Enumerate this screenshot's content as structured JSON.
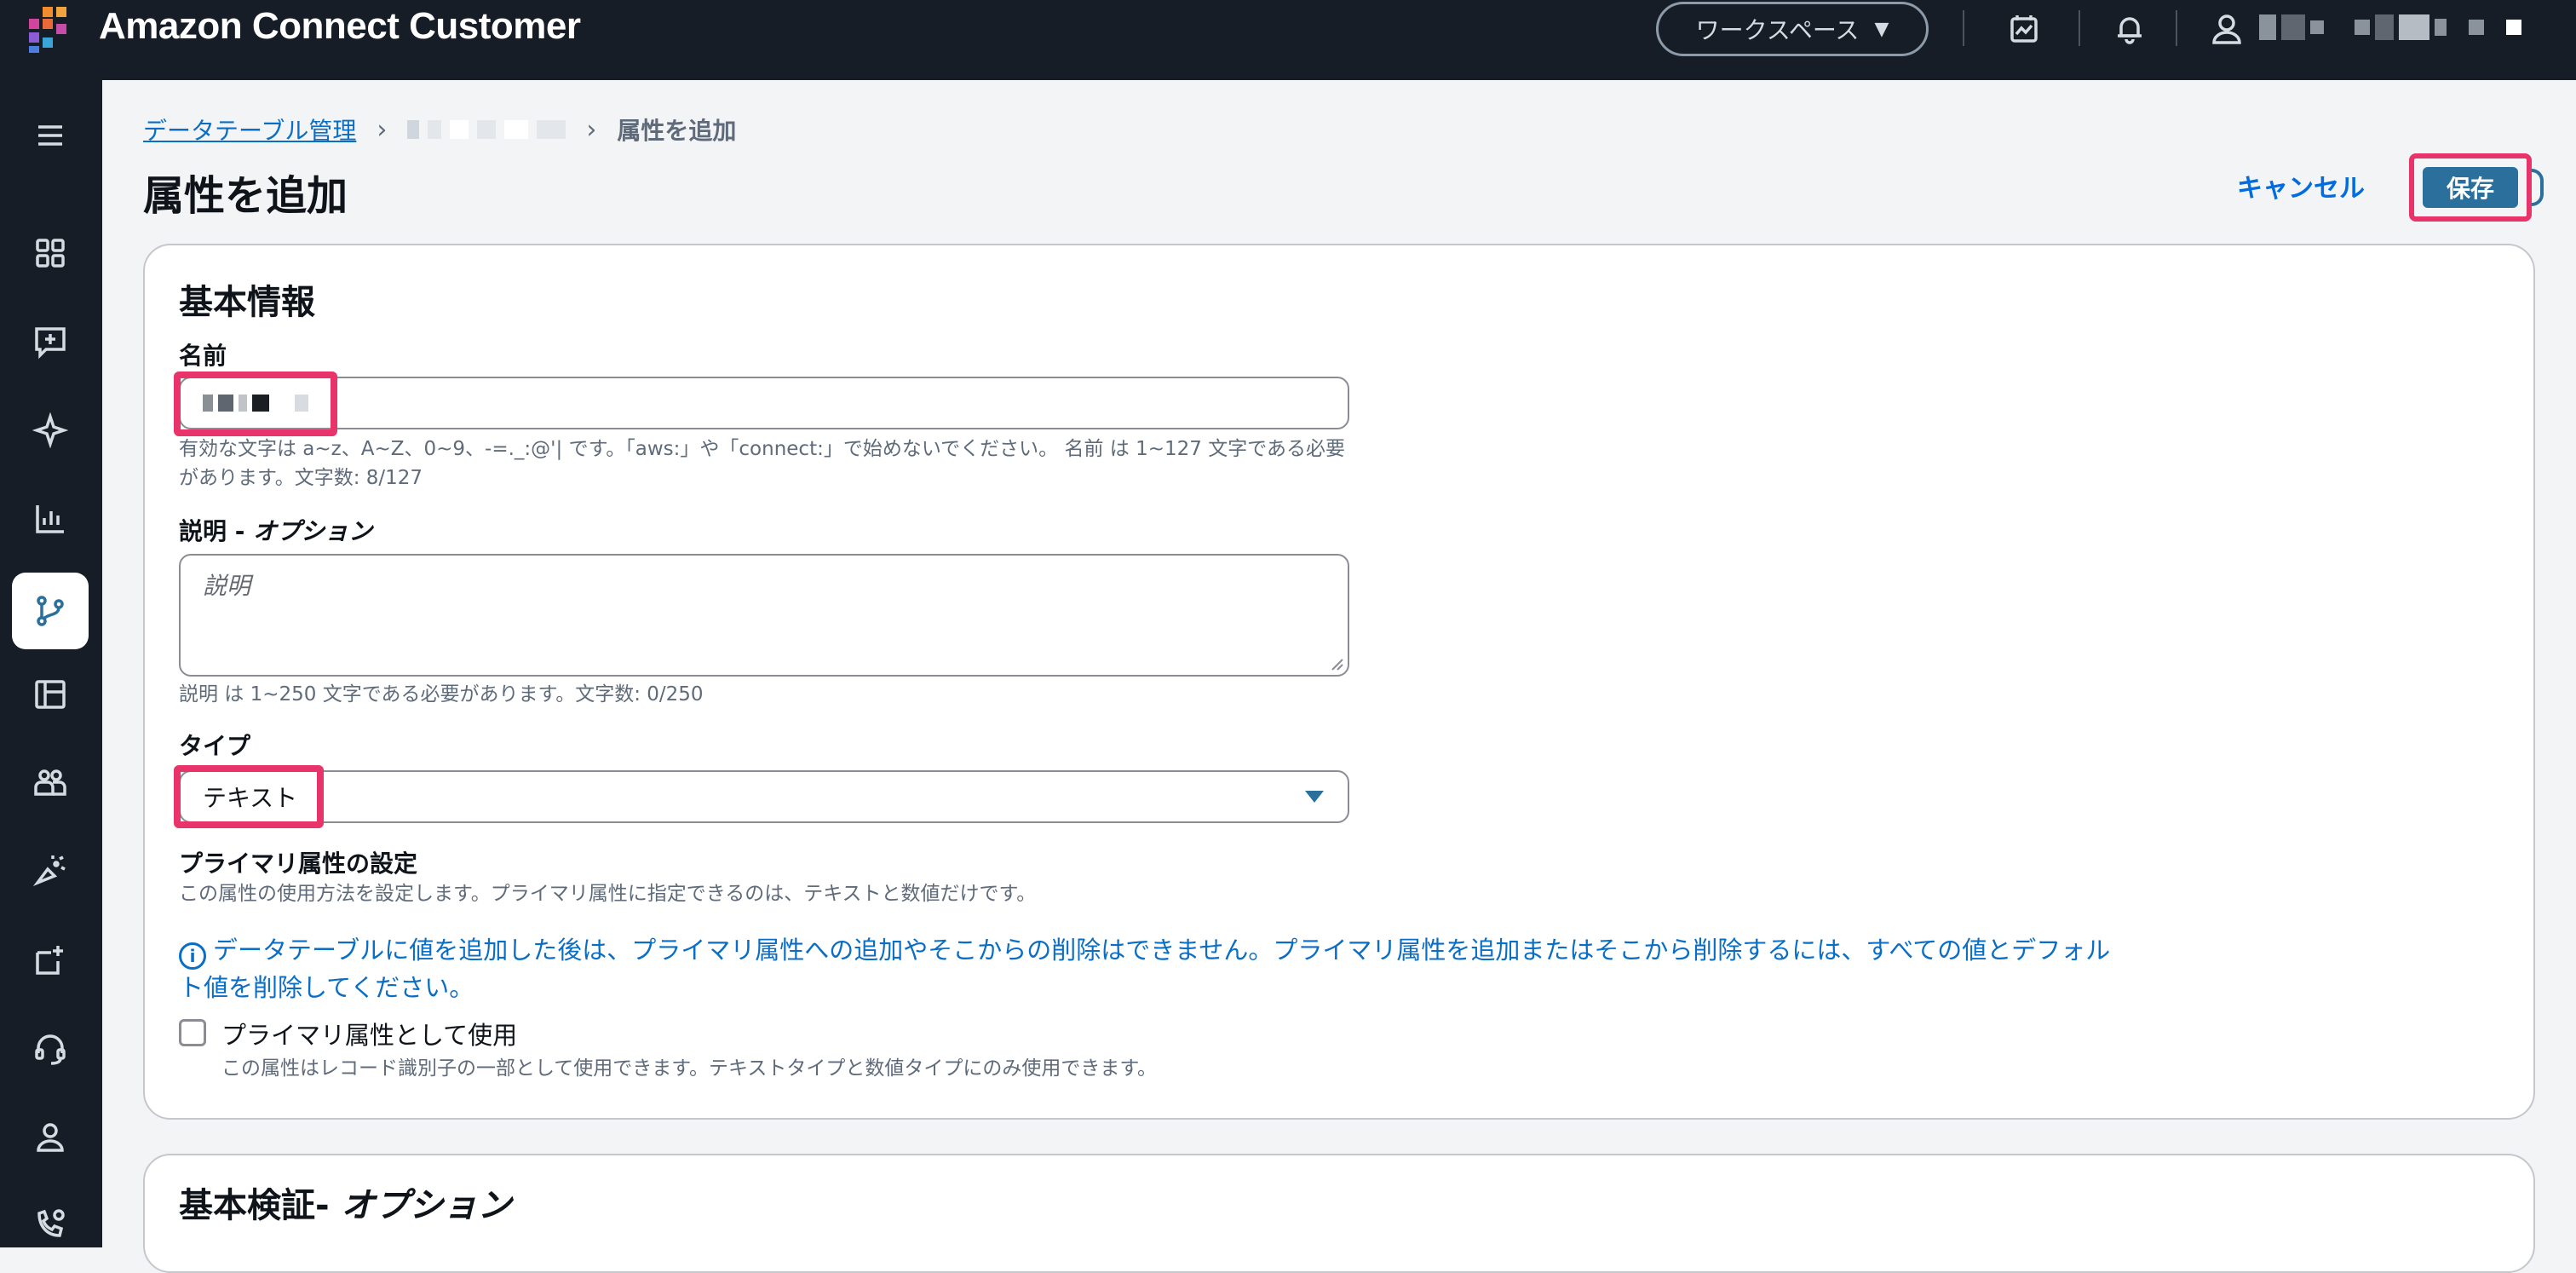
{
  "app": {
    "title": "Amazon Connect Customer"
  },
  "topbar": {
    "workspace_label": "ワークスペース",
    "icons": [
      "calendar-chart-icon",
      "bell-icon",
      "user-icon"
    ]
  },
  "sidebar": {
    "items": [
      {
        "name": "menu",
        "icon": "hamburger-icon"
      },
      {
        "name": "dashboard",
        "icon": "grid-icon"
      },
      {
        "name": "messages",
        "icon": "chat-plus-icon"
      },
      {
        "name": "ai",
        "icon": "sparkle-icon"
      },
      {
        "name": "analytics",
        "icon": "bar-chart-icon"
      },
      {
        "name": "routing",
        "icon": "flow-branch-icon",
        "active": true
      },
      {
        "name": "layout",
        "icon": "table-layout-icon"
      },
      {
        "name": "users",
        "icon": "users-icon"
      },
      {
        "name": "campaigns",
        "icon": "megaphone-icon"
      },
      {
        "name": "integrations",
        "icon": "app-plus-icon"
      },
      {
        "name": "channels",
        "icon": "headset-icon"
      },
      {
        "name": "profile",
        "icon": "person-icon"
      },
      {
        "name": "phone",
        "icon": "phone-settings-icon"
      }
    ]
  },
  "breadcrumb": {
    "link": "データテーブル管理",
    "current": "属性を追加"
  },
  "header": {
    "title": "属性を追加",
    "cancel_label": "キャンセル",
    "save_label": "保存"
  },
  "basic_info": {
    "title": "基本情報",
    "name": {
      "label": "名前",
      "hint": "有効な文字は a~z、A~Z、0~9、-=._:@'| です。「aws:」や「connect:」で始めないでください。 名前 は 1~127 文字である必要があります。文字数: 8/127"
    },
    "description": {
      "label": "説明 - ",
      "label_optional": "オプション",
      "placeholder": "説明",
      "hint": "説明 は 1~250 文字である必要があります。文字数: 0/250"
    },
    "type": {
      "label": "タイプ",
      "value": "テキスト"
    },
    "primary": {
      "title": "プライマリ属性の設定",
      "desc": "この属性の使用方法を設定します。プライマリ属性に指定できるのは、テキストと数値だけです。",
      "info": "データテーブルに値を追加した後は、プライマリ属性への追加やそこからの削除はできません。プライマリ属性を追加またはそこから削除するには、すべての値とデフォルト値を削除してください。",
      "checkbox_label": "プライマリ属性として使用",
      "checkbox_desc": "この属性はレコード識別子の一部として使用できます。テキストタイプと数値タイプにのみ使用できます。",
      "checked": false
    }
  },
  "validation": {
    "title": "基本検証- ",
    "title_optional": "オプション"
  },
  "colors": {
    "accent": "#e8336b",
    "link": "#0b6ec5",
    "primary_button": "#2b6f9c",
    "nav_bg": "#161d26"
  }
}
